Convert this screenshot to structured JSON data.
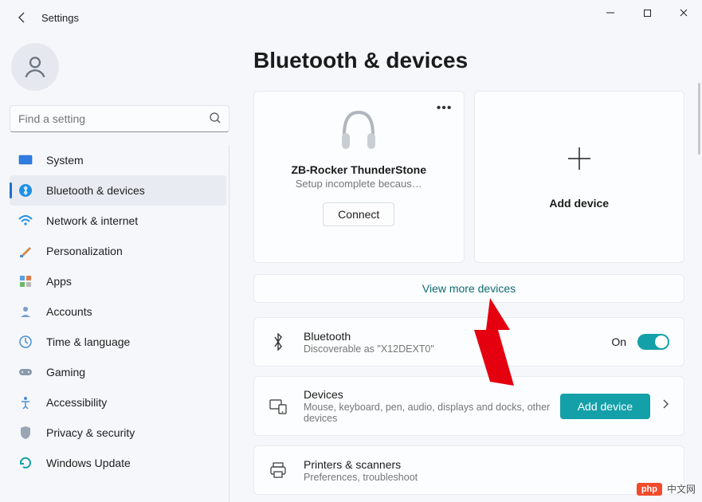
{
  "window": {
    "title": "Settings"
  },
  "search": {
    "placeholder": "Find a setting"
  },
  "sidebar": {
    "items": [
      {
        "label": "System"
      },
      {
        "label": "Bluetooth & devices"
      },
      {
        "label": "Network & internet"
      },
      {
        "label": "Personalization"
      },
      {
        "label": "Apps"
      },
      {
        "label": "Accounts"
      },
      {
        "label": "Time & language"
      },
      {
        "label": "Gaming"
      },
      {
        "label": "Accessibility"
      },
      {
        "label": "Privacy & security"
      },
      {
        "label": "Windows Update"
      }
    ],
    "active_index": 1
  },
  "page": {
    "title": "Bluetooth & devices"
  },
  "device_card": {
    "name": "ZB-Rocker ThunderStone",
    "subtitle": "Setup incomplete becaus…",
    "button": "Connect"
  },
  "add_card": {
    "label": "Add device"
  },
  "view_more": "View more devices",
  "bluetooth_row": {
    "title": "Bluetooth",
    "subtitle": "Discoverable as \"X12DEXT0\"",
    "state_label": "On"
  },
  "devices_row": {
    "title": "Devices",
    "subtitle": "Mouse, keyboard, pen, audio, displays and docks, other devices",
    "button": "Add device"
  },
  "printers_row": {
    "title": "Printers & scanners",
    "subtitle": "Preferences, troubleshoot"
  },
  "watermark": {
    "badge": "php",
    "text": "中文网"
  }
}
